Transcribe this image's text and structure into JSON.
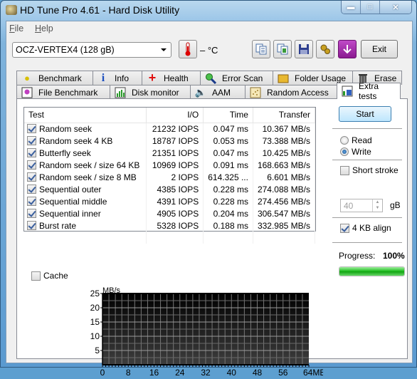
{
  "window": {
    "title": "HD Tune Pro 4.61 - Hard Disk Utility",
    "controls": [
      "minimize",
      "maximize",
      "close"
    ]
  },
  "menu": [
    {
      "label": "File",
      "accel": "F",
      "rest": "ile"
    },
    {
      "label": "Help",
      "accel": "H",
      "rest": "elp"
    }
  ],
  "toolbar": {
    "drive": "OCZ-VERTEX4 (128 gB)",
    "temperature": "– °C",
    "buttons": [
      "copy-text",
      "copy-screenshot",
      "save",
      "options",
      "download"
    ],
    "exit_label": "Exit"
  },
  "tabs": {
    "row1": [
      "Benchmark",
      "Info",
      "Health",
      "Error Scan",
      "Folder Usage",
      "Erase"
    ],
    "row2": [
      "File Benchmark",
      "Disk monitor",
      "AAM",
      "Random Access",
      "Extra tests"
    ],
    "active": "Extra tests"
  },
  "results": {
    "columns": [
      "Test",
      "I/O",
      "Time",
      "Transfer"
    ],
    "rows": [
      {
        "checked": true,
        "test": "Random seek",
        "io": "21232 IOPS",
        "time": "0.047 ms",
        "transfer": "10.367 MB/s"
      },
      {
        "checked": true,
        "test": "Random seek 4 KB",
        "io": "18787 IOPS",
        "time": "0.053 ms",
        "transfer": "73.388 MB/s"
      },
      {
        "checked": true,
        "test": "Butterfly seek",
        "io": "21351 IOPS",
        "time": "0.047 ms",
        "transfer": "10.425 MB/s"
      },
      {
        "checked": true,
        "test": "Random seek / size 64 KB",
        "io": "10969 IOPS",
        "time": "0.091 ms",
        "transfer": "168.663 MB/s"
      },
      {
        "checked": true,
        "test": "Random seek / size 8 MB",
        "io": "2 IOPS",
        "time": "614.325 ...",
        "transfer": "6.601 MB/s"
      },
      {
        "checked": true,
        "test": "Sequential outer",
        "io": "4385 IOPS",
        "time": "0.228 ms",
        "transfer": "274.088 MB/s"
      },
      {
        "checked": true,
        "test": "Sequential middle",
        "io": "4391 IOPS",
        "time": "0.228 ms",
        "transfer": "274.456 MB/s"
      },
      {
        "checked": true,
        "test": "Sequential inner",
        "io": "4905 IOPS",
        "time": "0.204 ms",
        "transfer": "306.547 MB/s"
      },
      {
        "checked": true,
        "test": "Burst rate",
        "io": "5328 IOPS",
        "time": "0.188 ms",
        "transfer": "332.985 MB/s"
      }
    ]
  },
  "side": {
    "start_label": "Start",
    "mode_options": [
      "Read",
      "Write"
    ],
    "mode_selected": "Write",
    "short_stroke_label": "Short stroke",
    "short_stroke_checked": false,
    "short_stroke_value": "40",
    "short_stroke_unit": "gB",
    "align_label": "4 KB align",
    "align_checked": true,
    "progress_label": "Progress:",
    "progress_text": "100%",
    "progress_value": 100
  },
  "cache": {
    "label": "Cache",
    "checked": false
  },
  "chart_data": {
    "type": "line",
    "title": "",
    "ylabel": "MB/s",
    "xlabel": "MB",
    "ylim": [
      0,
      25
    ],
    "xlim": [
      0,
      64
    ],
    "yticks": [
      "25",
      "20",
      "15",
      "10",
      "5"
    ],
    "ytick_values": [
      25,
      20,
      15,
      10,
      5
    ],
    "xticks": [
      "0",
      "8",
      "16",
      "24",
      "32",
      "40",
      "48",
      "56",
      "64MB"
    ],
    "xtick_values": [
      0,
      8,
      16,
      24,
      32,
      40,
      48,
      56,
      64
    ],
    "grid": true,
    "series": []
  }
}
